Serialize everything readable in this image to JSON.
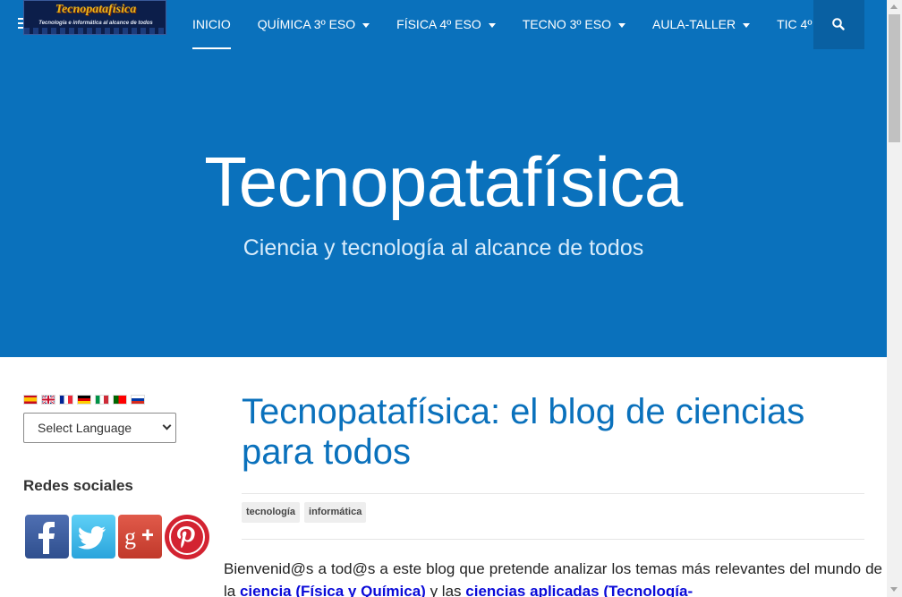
{
  "nav": {
    "logo_title": "Tecnopatafísica",
    "logo_sub": "Tecnología e informática al alcance de todos",
    "items": [
      {
        "label": "INICIO",
        "active": true,
        "has_caret": false
      },
      {
        "label": "QUÍMICA 3º ESO",
        "active": false,
        "has_caret": true
      },
      {
        "label": "FÍSICA 4º ESO",
        "active": false,
        "has_caret": true
      },
      {
        "label": "TECNO 3º ESO",
        "active": false,
        "has_caret": true
      },
      {
        "label": "AULA-TALLER",
        "active": false,
        "has_caret": true
      },
      {
        "label": "TIC 4º",
        "active": false,
        "has_caret": false
      }
    ]
  },
  "hero": {
    "title": "Tecnopatafísica",
    "subtitle": "Ciencia y tecnología al alcance de todos"
  },
  "sidebar": {
    "flags": [
      "es",
      "en",
      "fr",
      "de",
      "it",
      "pt",
      "ru"
    ],
    "language_select": "Select Language",
    "social_heading": "Redes sociales",
    "social": [
      "facebook",
      "twitter",
      "google-plus",
      "pinterest"
    ]
  },
  "post": {
    "title": "Tecnopatafísica: el blog de ciencias para todos",
    "tags": [
      "tecnología",
      "informática"
    ],
    "intro_1": "Bienvenid@s a tod@s a este blog que pretende analizar los temas más relevantes del mundo de la",
    "link_1": "ciencia (Física y Química)",
    "intro_2": "y las",
    "link_2": "ciencias aplicadas (Tecnología-"
  },
  "colors": {
    "brand_blue": "#0a71bc",
    "link_blue": "#0a0ad8"
  }
}
